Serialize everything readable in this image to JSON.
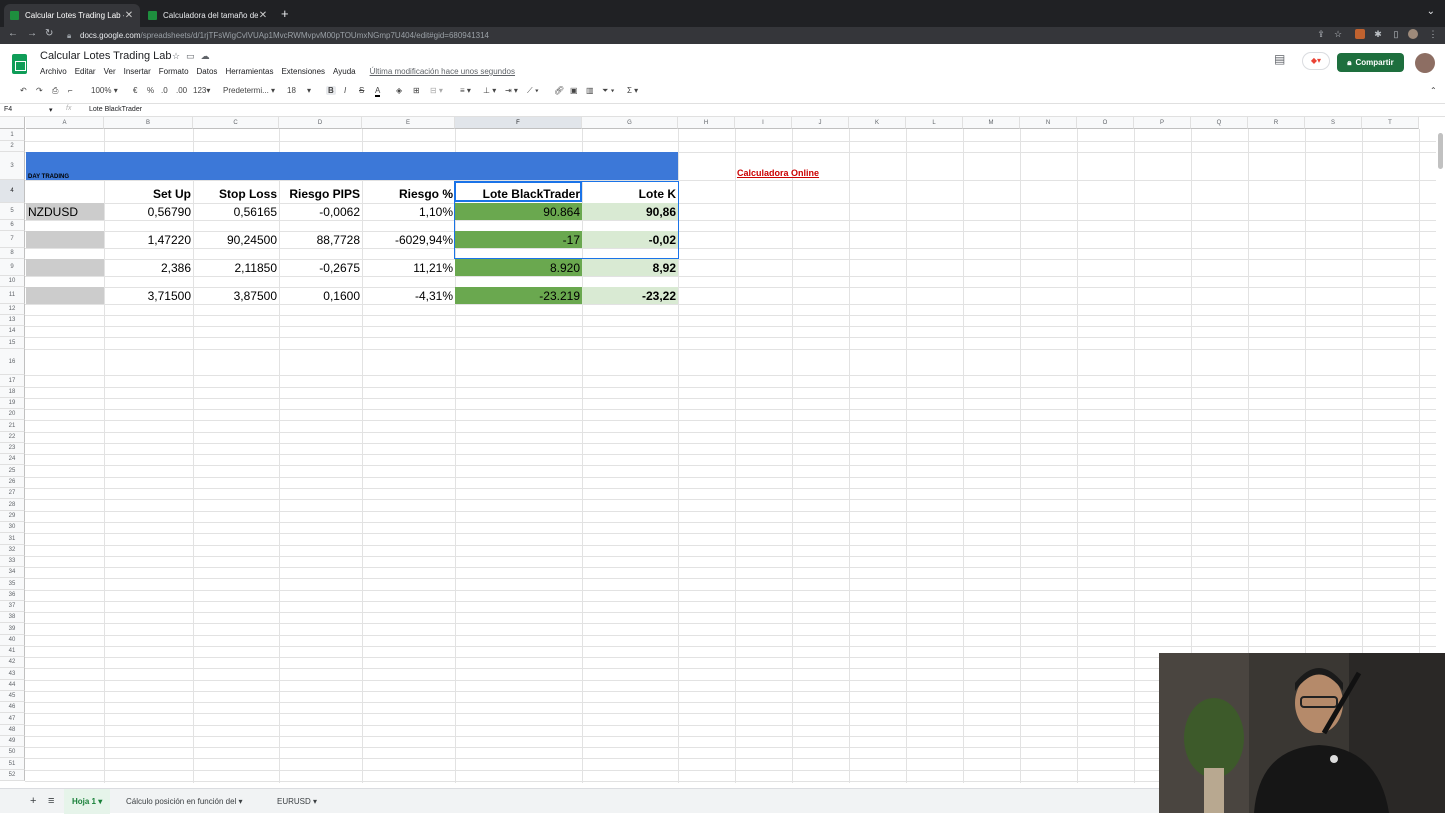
{
  "browser": {
    "tabs": [
      {
        "title": "Calcular Lotes Trading Lab - H",
        "active": true
      },
      {
        "title": "Calculadora del tamaño de po",
        "active": false
      }
    ],
    "url_host": "docs.google.com",
    "url_path": "/spreadsheets/d/1rjTFsWigCvlVUAp1MvcRWMvpvM00pTOUmxNGmp7U404/edit#gid=680941314"
  },
  "doc": {
    "title": "Calcular Lotes Trading Lab",
    "menus": [
      "Archivo",
      "Editar",
      "Ver",
      "Insertar",
      "Formato",
      "Datos",
      "Herramientas",
      "Extensiones",
      "Ayuda"
    ],
    "last_modified": "Última modificación hace unos segundos",
    "share_label": "Compartir"
  },
  "toolbar": {
    "zoom": "100%",
    "currency": "€",
    "percent": "%",
    "dec_less": ".0",
    "dec_more": ".00",
    "format_123": "123",
    "font": "Predetermi...",
    "font_size": "18",
    "bold": "B",
    "italic": "I",
    "strike": "S",
    "text_color": "A"
  },
  "formula_bar": {
    "name_box": "F4",
    "fx": "fx",
    "value": "Lote BlackTrader"
  },
  "columns": [
    "A",
    "B",
    "C",
    "D",
    "E",
    "F",
    "G",
    "H",
    "I",
    "J",
    "K",
    "L",
    "M",
    "N",
    "O",
    "P",
    "Q",
    "R",
    "S",
    "T"
  ],
  "rows": [
    "1",
    "2",
    "3",
    "4",
    "5",
    "6",
    "7",
    "8",
    "9",
    "10",
    "11",
    "12",
    "13",
    "14",
    "15",
    "16",
    "17",
    "18",
    "19",
    "20",
    "21",
    "22",
    "23",
    "24",
    "25",
    "26",
    "27",
    "28",
    "29",
    "30",
    "31",
    "32",
    "33",
    "34",
    "35",
    "36",
    "37",
    "38",
    "39",
    "40",
    "41",
    "42",
    "43",
    "44",
    "45",
    "46",
    "47",
    "48",
    "49",
    "50",
    "51",
    "52"
  ],
  "sheet": {
    "banner_label": "DAY TRADING",
    "headers": [
      "Set Up",
      "Stop Loss",
      "Riesgo PIPS",
      "Riesgo %",
      "Lote BlackTrader",
      "Lote K"
    ],
    "data_rows": [
      {
        "pair": "NZDUSD",
        "setup": "0,56790",
        "stop": "0,56165",
        "pips": "-0,0062",
        "risk": "1,10%",
        "lote_bt": "90.864",
        "lote_k": "90,86"
      },
      {
        "pair": "",
        "setup": "1,47220",
        "stop": "90,24500",
        "pips": "88,7728",
        "risk": "-6029,94%",
        "lote_bt": "-17",
        "lote_k": "-0,02"
      },
      {
        "pair": "",
        "setup": "2,386",
        "stop": "2,11850",
        "pips": "-0,2675",
        "risk": "11,21%",
        "lote_bt": "8.920",
        "lote_k": "8,92"
      },
      {
        "pair": "",
        "setup": "3,71500",
        "stop": "3,87500",
        "pips": "0,1600",
        "risk": "-4,31%",
        "lote_bt": "-23.219",
        "lote_k": "-23,22"
      }
    ],
    "link_text": "Calculadora Online"
  },
  "sheet_tabs": {
    "add": "+",
    "list": "≡",
    "tabs": [
      "Hoja 1",
      "Cálculo posición en función del",
      "EURUSD"
    ]
  },
  "colors": {
    "banner": "#3c78d8",
    "lote_bt": "#6aa84f",
    "lote_k": "#d9ead3",
    "pair_cell": "#cccccc",
    "share": "#1e6f3e"
  }
}
